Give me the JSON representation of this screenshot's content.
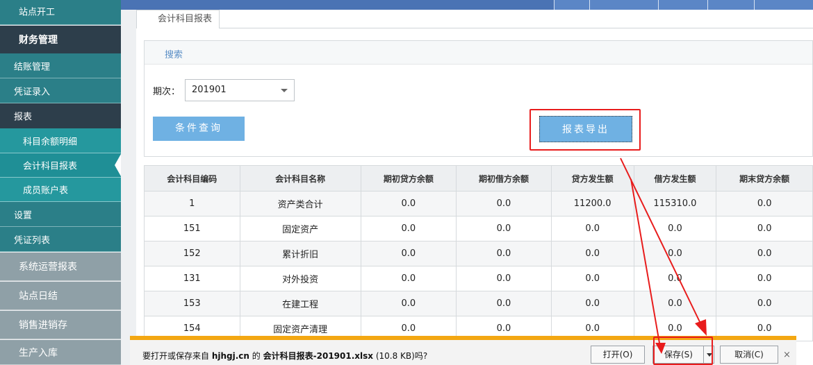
{
  "sidebar": {
    "items": [
      {
        "label": "站点开工",
        "style": "teal-top"
      },
      {
        "label": "财务管理",
        "style": "dark"
      },
      {
        "label": "结账管理",
        "style": "teal"
      },
      {
        "label": "凭证录入",
        "style": "teal"
      },
      {
        "label": "报表",
        "style": "dark"
      },
      {
        "label": "科目余额明细",
        "style": "sub"
      },
      {
        "label": "会计科目报表",
        "style": "sub-active"
      },
      {
        "label": "成员账户表",
        "style": "sub"
      },
      {
        "label": "设置",
        "style": "teal"
      },
      {
        "label": "凭证列表",
        "style": "teal"
      },
      {
        "label": "系统运营报表",
        "style": "gray"
      },
      {
        "label": "站点日结",
        "style": "gray"
      },
      {
        "label": "销售进销存",
        "style": "gray"
      },
      {
        "label": "生产入库",
        "style": "gray"
      }
    ]
  },
  "tab": {
    "label": "会计科目报表"
  },
  "search": {
    "header": "搜索",
    "period_label": "期次：",
    "period_value": "201901",
    "query_button": "条件查询",
    "export_button": "报表导出"
  },
  "table": {
    "columns": [
      "会计科目编码",
      "会计科目名称",
      "期初贷方余额",
      "期初借方余额",
      "贷方发生额",
      "借方发生额",
      "期末贷方余额"
    ],
    "rows": [
      [
        "1",
        "资产类合计",
        "0.0",
        "0.0",
        "11200.0",
        "115310.0",
        "0.0"
      ],
      [
        "151",
        "固定资产",
        "0.0",
        "0.0",
        "0.0",
        "0.0",
        "0.0"
      ],
      [
        "152",
        "累计折旧",
        "0.0",
        "0.0",
        "0.0",
        "0.0",
        "0.0"
      ],
      [
        "131",
        "对外投资",
        "0.0",
        "0.0",
        "0.0",
        "0.0",
        "0.0"
      ],
      [
        "153",
        "在建工程",
        "0.0",
        "0.0",
        "0.0",
        "0.0",
        "0.0"
      ],
      [
        "154",
        "固定资产清理",
        "0.0",
        "0.0",
        "0.0",
        "0.0",
        "0.0"
      ]
    ]
  },
  "download": {
    "msg_prefix": "要打开或保存来自",
    "domain": "hjhgj.cn",
    "msg_mid": "的",
    "filename": "会计科目报表-201901.xlsx",
    "size": "(10.8 KB)吗?",
    "open_label": "打开(O)",
    "save_label": "保存(S)",
    "cancel_label": "取消(C)",
    "close_glyph": "×"
  },
  "colors": {
    "accent_blue": "#6fb1e3",
    "highlight_red": "#e81c1c",
    "download_bar_orange": "#f3a712"
  }
}
